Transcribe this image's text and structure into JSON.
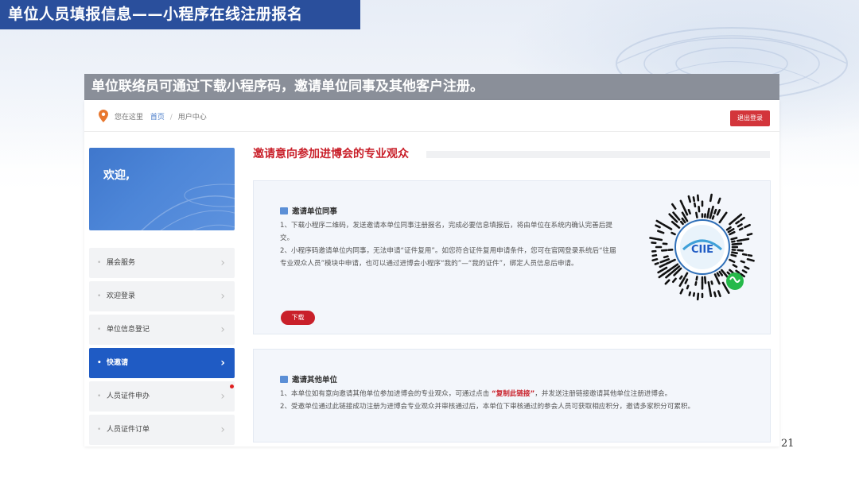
{
  "slide": {
    "title": "单位人员填报信息——小程序在线注册报名",
    "subtitle": "单位联络员可通过下载小程序码，邀请单位同事及其他客户注册。",
    "page_number": "21"
  },
  "header": {
    "location_label": "您在这里",
    "breadcrumb_home": "首页",
    "breadcrumb_sep": "/",
    "breadcrumb_current": "用户中心",
    "logout_label": "退出登录"
  },
  "sidebar": {
    "welcome": "欢迎,",
    "items": [
      {
        "label": "展会服务"
      },
      {
        "label": "欢迎登录"
      },
      {
        "label": "单位信息登记"
      },
      {
        "label": "快邀请",
        "active": true
      },
      {
        "label": "人员证件申办",
        "badge": true
      },
      {
        "label": "人员证件订单"
      }
    ]
  },
  "main": {
    "section_title": "邀请意向参加进博会的专业观众",
    "panel1": {
      "heading": "邀请单位同事",
      "line1": "1、下载小程序二维码，发送邀请本单位同事注册报名，完成必要信息填报后，将由单位在系统内确认完善后提交。",
      "line2": "2、小程序码邀请单位内同事，无法申请“证件复用”。如您符合证件复用申请条件，您可在官网登录系统后“往届专业观众人员”模块中申请，也可以通过进博会小程序“我的”—“我的证件”，绑定人员信息后申请。",
      "download_label": "下载",
      "qr_logo_text": "CIIE"
    },
    "panel2": {
      "heading": "邀请其他单位",
      "line1_a": "1、本单位如有意向邀请其他单位参加进博会的专业观众，可通过点击 ",
      "line1_link": "“复制此链接”",
      "line1_b": "，并发送注册链接邀请其他单位注册进博会。",
      "line2": "2、受邀单位通过此链接成功注册为进博会专业观众并审核通过后，本单位下审核通过的参会人员可获取相应积分，邀请多家积分可累积。"
    }
  },
  "colors": {
    "title_bar": "#2a4f9c",
    "subtitle_bar": "#8a8f99",
    "accent_red": "#c9202a",
    "active_blue": "#1f5bc4"
  }
}
